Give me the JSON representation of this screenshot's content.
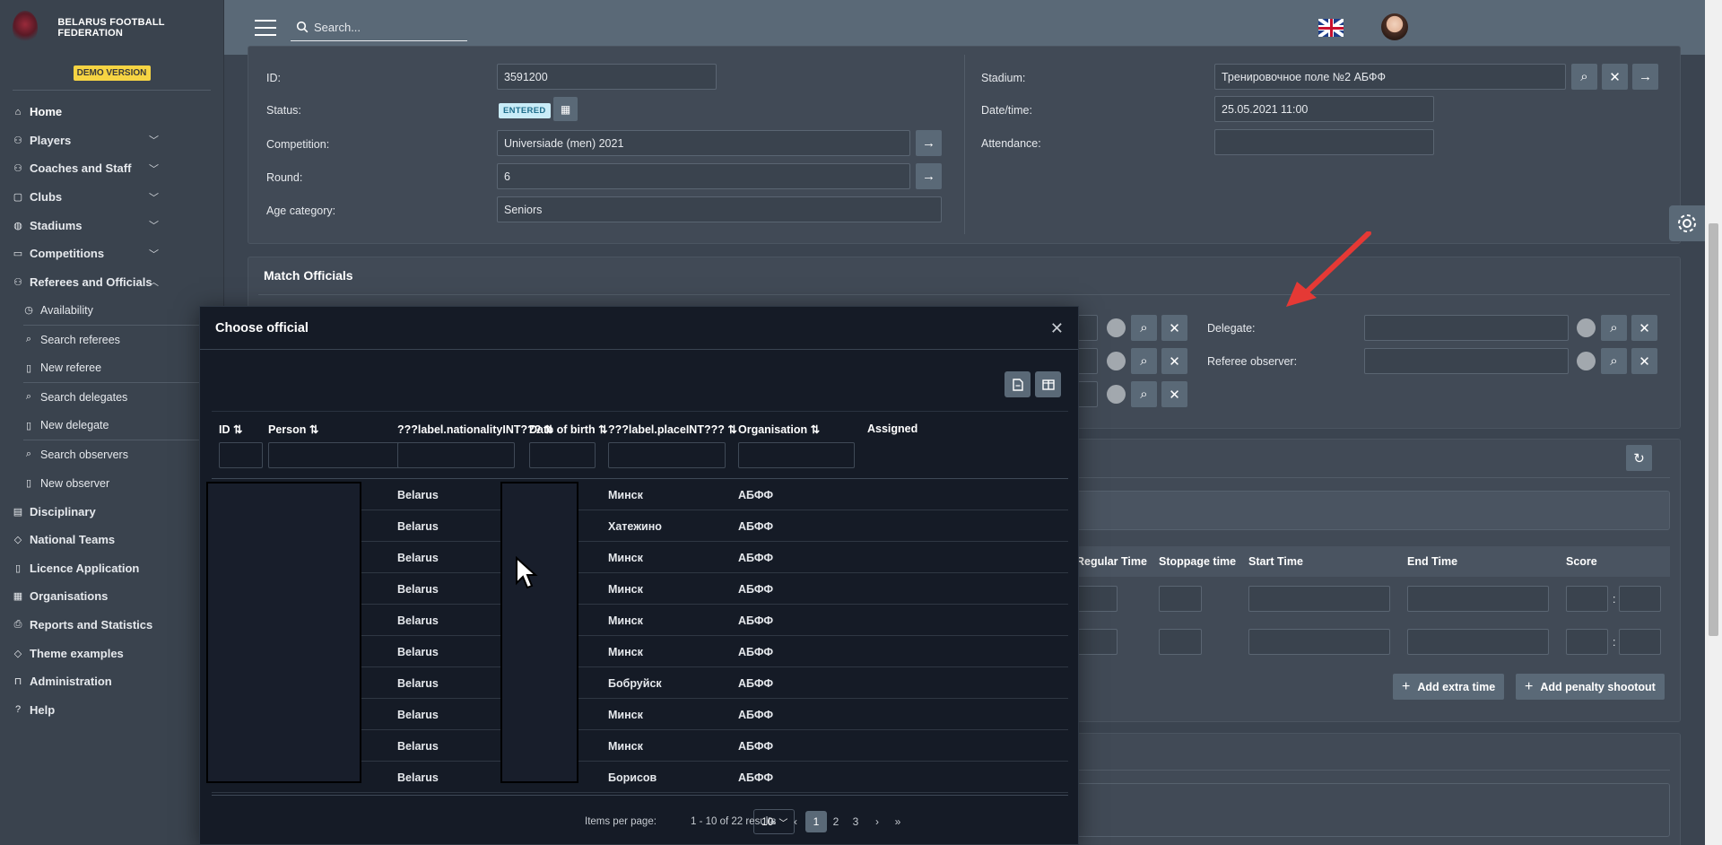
{
  "brand": {
    "name": "BELARUS FOOTBALL FEDERATION",
    "demo_label": "DEMO VERSION"
  },
  "topbar": {
    "search_placeholder": "Search..."
  },
  "sidebar": {
    "items": [
      {
        "label": "Home",
        "icon": "home-icon"
      },
      {
        "label": "Players",
        "icon": "players-icon"
      },
      {
        "label": "Coaches and Staff",
        "icon": "coaches-icon"
      },
      {
        "label": "Clubs",
        "icon": "clubs-icon"
      },
      {
        "label": "Stadiums",
        "icon": "globe-icon"
      },
      {
        "label": "Competitions",
        "icon": "competitions-icon"
      },
      {
        "label": "Referees and Officials",
        "icon": "referees-icon"
      },
      {
        "label": "Availability",
        "icon": "clock-icon"
      },
      {
        "label": "Search referees",
        "icon": "search-icon"
      },
      {
        "label": "New referee",
        "icon": "document-icon"
      },
      {
        "label": "Search delegates",
        "icon": "search-icon"
      },
      {
        "label": "New delegate",
        "icon": "document-icon"
      },
      {
        "label": "Search observers",
        "icon": "search-icon"
      },
      {
        "label": "New observer",
        "icon": "document-icon"
      },
      {
        "label": "Disciplinary",
        "icon": "disciplinary-icon"
      },
      {
        "label": "National Teams",
        "icon": "tag-icon"
      },
      {
        "label": "Licence Application",
        "icon": "bookmark-icon"
      },
      {
        "label": "Organisations",
        "icon": "organisations-icon"
      },
      {
        "label": "Reports and Statistics",
        "icon": "reports-icon"
      },
      {
        "label": "Theme examples",
        "icon": "tag-icon"
      },
      {
        "label": "Administration",
        "icon": "lock-icon"
      },
      {
        "label": "Help",
        "icon": "help-icon"
      }
    ]
  },
  "match": {
    "id_label": "ID:",
    "id_value": "3591200",
    "status_label": "Status:",
    "status_value": "ENTERED",
    "competition_label": "Competition:",
    "competition_value": "Universiade (men) 2021",
    "round_label": "Round:",
    "round_value": "6",
    "age_label": "Age category:",
    "age_value": "Seniors",
    "stadium_label": "Stadium:",
    "stadium_value": "Тренировочное поле №2 АБФФ",
    "datetime_label": "Date/time:",
    "datetime_value": "25.05.2021 11:00",
    "attendance_label": "Attendance:",
    "attendance_value": ""
  },
  "officials": {
    "title": "Match Officials",
    "delegate_label": "Delegate:",
    "observer_label": "Referee observer:"
  },
  "periods": {
    "headers": [
      "Regular Time",
      "Stoppage time",
      "Start Time",
      "End Time",
      "Score"
    ],
    "add_extra_time": "Add extra time",
    "add_penalty": "Add penalty shootout"
  },
  "modal": {
    "title": "Choose official",
    "columns": [
      "ID",
      "Person",
      "???label.nationalityINT???",
      "Date of birth",
      "???label.placeINT???",
      "Organisation",
      "Assigned"
    ],
    "rows": [
      {
        "nationality": "Belarus",
        "place": "Минск",
        "organisation": "АБФФ"
      },
      {
        "nationality": "Belarus",
        "place": "Хатежино",
        "organisation": "АБФФ"
      },
      {
        "nationality": "Belarus",
        "place": "Минск",
        "organisation": "АБФФ"
      },
      {
        "nationality": "Belarus",
        "place": "Минск",
        "organisation": "АБФФ"
      },
      {
        "nationality": "Belarus",
        "place": "Минск",
        "organisation": "АБФФ"
      },
      {
        "nationality": "Belarus",
        "place": "Минск",
        "organisation": "АБФФ"
      },
      {
        "nationality": "Belarus",
        "place": "Бобруйск",
        "organisation": "АБФФ"
      },
      {
        "nationality": "Belarus",
        "place": "Минск",
        "organisation": "АБФФ"
      },
      {
        "nationality": "Belarus",
        "place": "Минск",
        "organisation": "АБФФ"
      },
      {
        "nationality": "Belarus",
        "place": "Борисов",
        "organisation": "АБФФ"
      }
    ],
    "items_per_page_label": "Items per page:",
    "items_per_page_value": "10",
    "range_text": "1 - 10 of 22 results",
    "pages": [
      "1",
      "2",
      "3"
    ],
    "current_page": "1"
  },
  "colors": {
    "accent": "#5a6977",
    "badge": "#c9ecf8",
    "demo": "#f6d443"
  }
}
